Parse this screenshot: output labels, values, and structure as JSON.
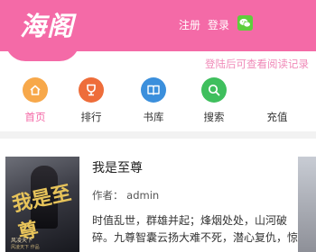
{
  "header": {
    "logo_text": "海阁",
    "register_label": "注册",
    "login_label": "登录",
    "wechat_icon": "wechat-icon",
    "bg_color": "#f46aa7"
  },
  "notice": "登陆后可查看阅读记录",
  "nav": [
    {
      "label": "首页",
      "icon": "home-icon",
      "color": "#f7a84a"
    },
    {
      "label": "排行",
      "icon": "trophy-icon",
      "color": "#ee6d3a"
    },
    {
      "label": "书库",
      "icon": "book-icon",
      "color": "#3b8fdc"
    },
    {
      "label": "搜索",
      "icon": "search-icon",
      "color": "#3fbf5d"
    },
    {
      "label": "充值",
      "icon": "recharge-icon",
      "color": "#f46aa7"
    }
  ],
  "book": {
    "title": "我是至尊",
    "author": "作者： admin",
    "desc_lines": [
      "时值乱世，群雄并起；烽烟处处，山河破",
      "碎。九尊智囊云扬大难不死，潜心复仇，惊"
    ],
    "cover_title": "我是至尊",
    "cover_subtitle": "风凌天下",
    "cover_author": "风凌天下 作品"
  }
}
